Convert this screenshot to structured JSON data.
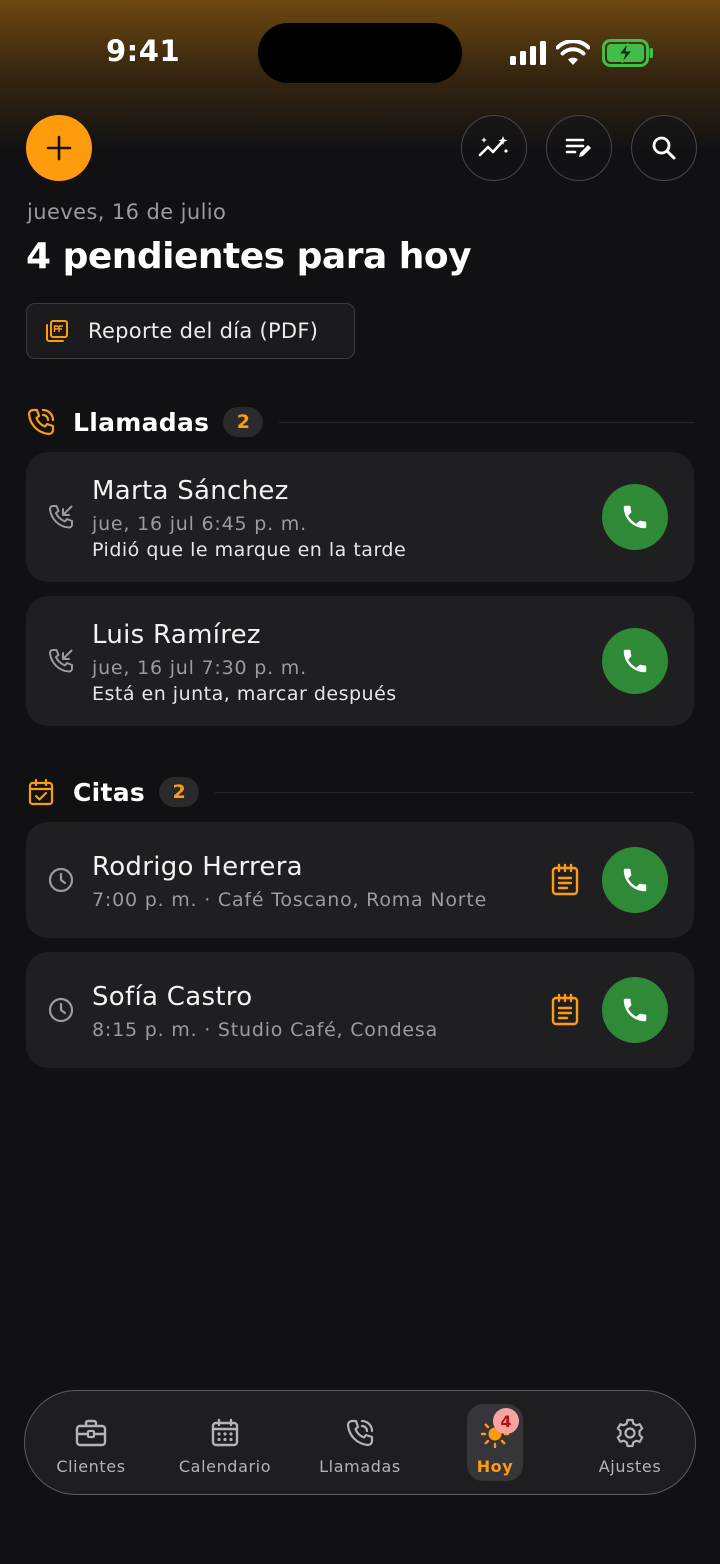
{
  "status_bar": {
    "time": "9:41"
  },
  "header": {
    "date": "jueves, 16 de julio",
    "headline": "4 pendientes para hoy",
    "pdf_button": "Reporte del día (PDF)"
  },
  "sections": {
    "calls": {
      "title": "Llamadas",
      "count": "2"
    },
    "appointments": {
      "title": "Citas",
      "count": "2"
    }
  },
  "calls": [
    {
      "name": "Marta Sánchez",
      "datetime": "jue, 16 jul 6:45 p. m.",
      "note": "Pidió que le marque en la tarde"
    },
    {
      "name": "Luis Ramírez",
      "datetime": "jue, 16 jul 7:30 p. m.",
      "note": "Está en junta, marcar después"
    }
  ],
  "appointments": [
    {
      "name": "Rodrigo Herrera",
      "details": "7:00 p. m. · Café Toscano, Roma Norte"
    },
    {
      "name": "Sofía Castro",
      "details": "8:15 p. m. · Studio Café, Condesa"
    }
  ],
  "tabs": [
    {
      "label": "Clientes",
      "icon": "briefcase-icon"
    },
    {
      "label": "Calendario",
      "icon": "calendar-icon"
    },
    {
      "label": "Llamadas",
      "icon": "phone-icon"
    },
    {
      "label": "Hoy",
      "icon": "sun-icon",
      "active": true,
      "badge": "4"
    },
    {
      "label": "Ajustes",
      "icon": "gear-icon"
    }
  ],
  "colors": {
    "accent": "#ff9c0e",
    "call_green": "#2e8a36",
    "background": "#111113",
    "card": "#1f1f22"
  }
}
